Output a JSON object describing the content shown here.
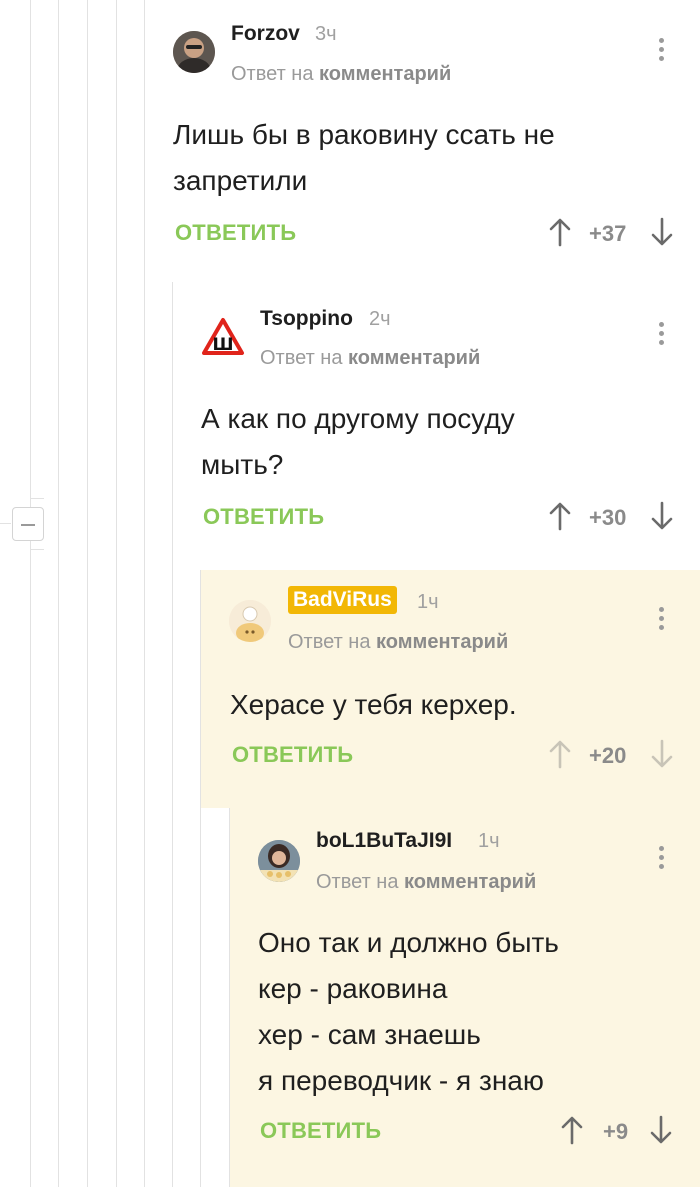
{
  "comments": [
    {
      "author": "Forzov",
      "time": "3ч",
      "reply_prefix": "Ответ на",
      "reply_target": "комментарий",
      "text_lines": [
        "Лишь бы в раковину ссать не",
        "запретили"
      ],
      "reply_label": "ОТВЕТИТЬ",
      "score": "+37"
    },
    {
      "author": "Tsoppino",
      "time": "2ч",
      "avatar_letter": "Ш",
      "reply_prefix": "Ответ на",
      "reply_target": "комментарий",
      "text_lines": [
        "А как по другому посуду",
        "мыть?"
      ],
      "reply_label": "ОТВЕТИТЬ",
      "score": "+30"
    },
    {
      "author": "BadViRus",
      "time": "1ч",
      "reply_prefix": "Ответ на",
      "reply_target": "комментарий",
      "text_lines": [
        "Херасе у тебя керхер."
      ],
      "reply_label": "ОТВЕТИТЬ",
      "score": "+20"
    },
    {
      "author": "boL1BuTaJI9I",
      "time": "1ч",
      "reply_prefix": "Ответ на",
      "reply_target": "комментарий",
      "text_lines": [
        "Оно так и должно быть",
        "кер - раковина",
        "хер - сам знаешь",
        "я переводчик - я знаю"
      ],
      "reply_label": "ОТВЕТИТЬ",
      "score": "+9"
    }
  ],
  "colors": {
    "accent_green": "#8ac858",
    "highlight_bg": "#fcf6e2",
    "author_badge": "#f2b705",
    "muted": "#9a9a9a"
  },
  "icons": {
    "upvote": "arrow-up-icon",
    "downvote": "arrow-down-icon",
    "more": "more-vertical-icon",
    "collapse": "minus-icon"
  }
}
